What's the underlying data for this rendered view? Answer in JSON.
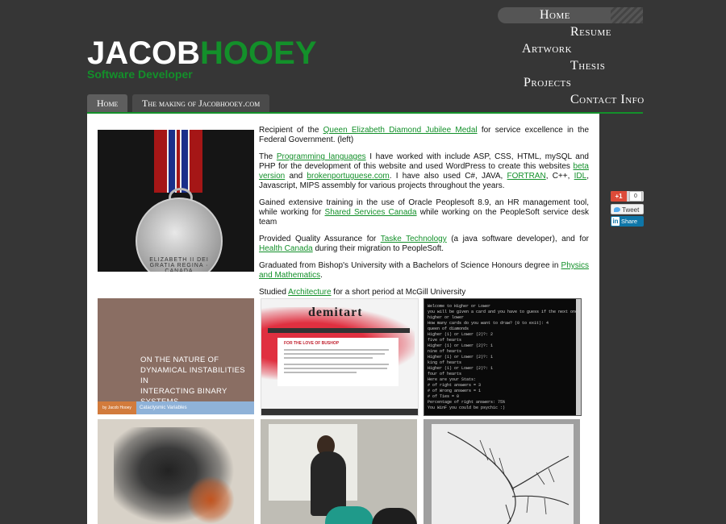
{
  "logo": {
    "part1": "JACOB",
    "part2": "HOOEY",
    "subtitle": "Software Developer"
  },
  "nav": {
    "home": "Home",
    "resume": "Resume",
    "artwork": "Artwork",
    "thesis": "Thesis",
    "projects": "Projects",
    "contact": "Contact Info"
  },
  "tabs": [
    "Home",
    "The making of Jacobhooey.com"
  ],
  "content": {
    "p1": {
      "pre": "Recipient of the ",
      "link": "Queen Elizabeth Diamond Jubilee Medal",
      "post": " for service excellence in the Federal Government. (left)"
    },
    "p2": {
      "pre": "The ",
      "link1": "Programming languages",
      "mid1": " I have worked with include ASP, CSS, HTML, mySQL and PHP for the development of this website and used WordPress to create this websites ",
      "link2": "beta version",
      "mid2": " and ",
      "link3": "brokenportuguese.com",
      "mid3": ". I have also used C#, JAVA, ",
      "link4": "FORTRAN",
      "mid4": ", C++, ",
      "link5": "IDL",
      "post": ", Javascript, MIPS assembly for various projects throughout the years."
    },
    "p3": {
      "pre": "Gained extensive training in the use of Oracle Peoplesoft 8.9, an HR management tool, while working for ",
      "link": "Shared Services Canada",
      "post": " while working on the PeopleSoft service desk team"
    },
    "p4": {
      "pre": "Provided Quality Assurance for ",
      "link1": "Taske Technology",
      "mid": " (a java software developer), and for ",
      "link2": "Health Canada",
      "post": " during their migration to PeopleSoft."
    },
    "p5": {
      "pre": "Graduated from Bishop's University with a Bachelors of Science Honours degree in ",
      "link": "Physics and Mathematics",
      "post": "."
    },
    "p6": {
      "pre": "Studied ",
      "link": "Architecture",
      "post": " for a short period at McGill University"
    }
  },
  "medal": {
    "inscription": "ELIZABETH II DEI GRATIA REGINA · CANADA"
  },
  "gallery": {
    "thesis": {
      "title_lines": [
        "ON THE NATURE OF",
        "DYNAMICAL INSTABILITIES IN",
        "INTERACTING BINARY",
        "SYSTEMS"
      ],
      "author": "by Jacob Hooey",
      "subtitle": "Cataclysmic Variables"
    },
    "demitart": {
      "logo": "demitart",
      "heading": "FOR THE LOVE OF BUSHOP"
    },
    "console": {
      "lines": [
        "Welcome to Higher or Lower",
        "you will be given a card and you have to guess if the next one is going to be",
        "higher or lower",
        "How many cards do you want to draw? (0 to exit): 4",
        "queen of diamonds",
        "Higher (1) or Lower (2)?: 2",
        "five of hearts",
        "Higher (1) or Lower (2)?: 1",
        "nine of hearts",
        "Higher (1) or Lower (2)?: 1",
        "king of hearts",
        "Higher (1) or Lower (2)?: 1",
        "four of hearts",
        "Here are your Stats:",
        "# of right answers = 3",
        "# of Wrong answers = 1",
        "# of Ties = 0",
        "Percentage of right answers: 75%",
        "You WinF you could be psychic :)",
        "",
        "Welcome to Higher or Lower",
        "you will be given a card and you have to guess if the next one is going to be",
        "higher or lower",
        "How many cards do you want to draw? (0 to exit): "
      ]
    }
  },
  "social": {
    "gplus": "+1",
    "gplus_count": "0",
    "tweet": "Tweet",
    "share": "Share"
  },
  "colors": {
    "background": "#363636",
    "accent_green": "#13902a",
    "content_bg": "#ffffff"
  }
}
